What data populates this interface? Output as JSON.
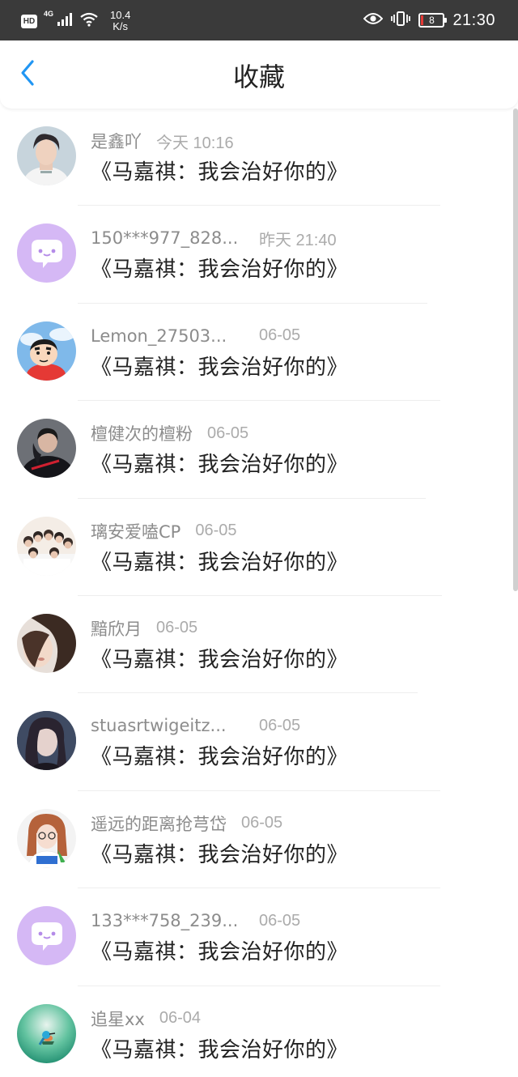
{
  "status_bar": {
    "hd": "HD",
    "network": "4G",
    "speed_value": "10.4",
    "speed_unit": "K/s",
    "battery_level": "8",
    "time": "21:30",
    "battery_color": "#e53935"
  },
  "header": {
    "title": "收藏",
    "back_icon": "chevron-left-icon",
    "accent_color": "#2196f3"
  },
  "favorites": [
    {
      "username": "是鑫吖",
      "time": "今天 10:16",
      "title": "《马嘉祺：我会治好你的》",
      "avatar": "photo-boy-white-shirt"
    },
    {
      "username": "150***977_828...",
      "time": "昨天 21:40",
      "title": "《马嘉祺：我会治好你的》",
      "avatar": "default-chat-bubble"
    },
    {
      "username": "Lemon_27503...",
      "time": "06-05",
      "title": "《马嘉祺：我会治好你的》",
      "avatar": "cartoon-crayon-shinchan"
    },
    {
      "username": "檀健次的檀粉",
      "time": "06-05",
      "title": "《马嘉祺：我会治好你的》",
      "avatar": "photo-man-dark-hoodie"
    },
    {
      "username": "璃安爱嗑CP",
      "time": "06-05",
      "title": "《马嘉祺：我会治好你的》",
      "avatar": "photo-group-boys"
    },
    {
      "username": "黯欣月",
      "time": "06-05",
      "title": "《马嘉祺：我会治好你的》",
      "avatar": "photo-girl-hair-over-face"
    },
    {
      "username": "stuasrtwigeitz...",
      "time": "06-05",
      "title": "《马嘉祺：我会治好你的》",
      "avatar": "photo-girl-long-hair"
    },
    {
      "username": "遥远的距离抢芎岱",
      "time": "06-05",
      "title": "《马嘉祺：我会治好你的》",
      "avatar": "photo-girl-glasses"
    },
    {
      "username": "133***758_239...",
      "time": "06-05",
      "title": "《马嘉祺：我会治好你的》",
      "avatar": "default-chat-bubble"
    },
    {
      "username": "追星xx",
      "time": "06-04",
      "title": "《马嘉祺：我会治好你的》",
      "avatar": "photo-green-bird"
    }
  ]
}
